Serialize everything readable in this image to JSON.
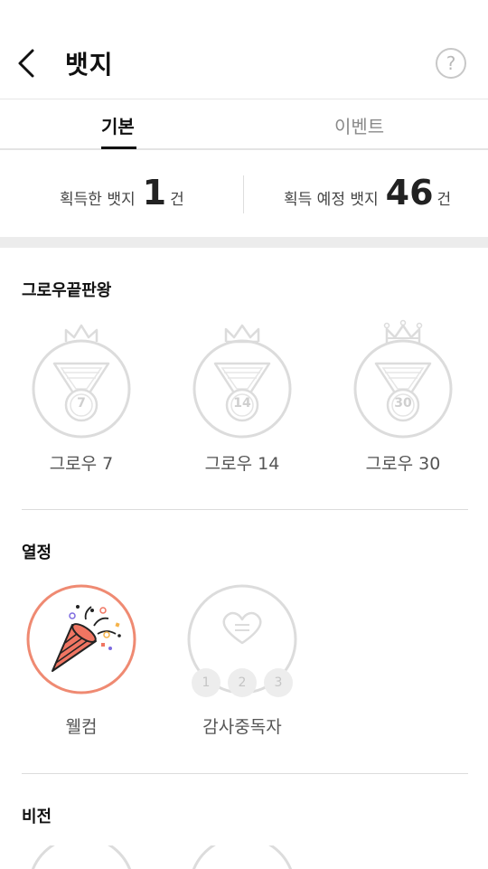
{
  "header": {
    "title": "뱃지",
    "back_icon": "chevron-left-icon",
    "help_label": "?"
  },
  "tabs": [
    {
      "label": "기본",
      "active": true
    },
    {
      "label": "이벤트",
      "active": false
    }
  ],
  "summary": {
    "acquired_label": "획득한 뱃지",
    "acquired_count": "1",
    "acquired_unit": "건",
    "expected_label": "획득 예정 뱃지",
    "expected_count": "46",
    "expected_unit": "건"
  },
  "sections": [
    {
      "title": "그로우끝판왕",
      "badges": [
        {
          "label": "그로우 7",
          "number": "7",
          "earned": false,
          "icon": "medal-icon"
        },
        {
          "label": "그로우 14",
          "number": "14",
          "earned": false,
          "icon": "medal-icon"
        },
        {
          "label": "그로우 30",
          "number": "30",
          "earned": false,
          "icon": "medal-icon"
        }
      ]
    },
    {
      "title": "열정",
      "badges": [
        {
          "label": "웰컴",
          "earned": true,
          "icon": "party-popper-icon"
        },
        {
          "label": "감사중독자",
          "earned": false,
          "icon": "heart-icon",
          "steps": [
            "1",
            "2",
            "3"
          ]
        }
      ]
    },
    {
      "title": "비전",
      "badges": []
    }
  ],
  "colors": {
    "earned_ring": "#ef8a72",
    "inactive": "#d9d9d9",
    "popper": "#f07562"
  }
}
